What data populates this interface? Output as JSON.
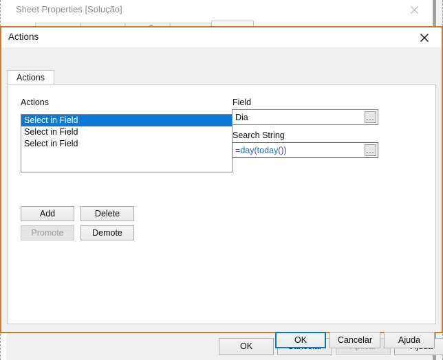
{
  "parent_window": {
    "title": "Sheet Properties [Solução]",
    "close_icon": "close-icon",
    "peek_tab_glyph": "T.",
    "footer_buttons": [
      {
        "label": "OK",
        "state": "enabled"
      },
      {
        "label": "Cancelar",
        "state": "enabled"
      },
      {
        "label": "Aplicar",
        "state": "disabled"
      },
      {
        "label": "Ajuda",
        "state": "enabled"
      }
    ]
  },
  "actions_dialog": {
    "title": "Actions",
    "close_icon": "close-icon",
    "tabs": [
      {
        "label": "Actions",
        "active": true
      }
    ],
    "left_panel": {
      "group_label": "Actions",
      "list_items": [
        {
          "label": "Select in Field",
          "selected": true
        },
        {
          "label": "Select in Field",
          "selected": false
        },
        {
          "label": "Select in Field",
          "selected": false
        }
      ],
      "buttons": [
        {
          "label": "Add",
          "state": "enabled"
        },
        {
          "label": "Delete",
          "state": "enabled"
        },
        {
          "label": "Promote",
          "state": "disabled"
        },
        {
          "label": "Demote",
          "state": "enabled"
        }
      ]
    },
    "right_panel": {
      "field_label": "Field",
      "field_value": "Dia",
      "field_browse_label": "...",
      "search_label": "Search String",
      "search_value": "=day(today())",
      "search_tokens": [
        {
          "text": "=",
          "kind": "op"
        },
        {
          "text": "day",
          "kind": "fn"
        },
        {
          "text": "(",
          "kind": "par"
        },
        {
          "text": "today",
          "kind": "fn"
        },
        {
          "text": "()",
          "kind": "par"
        },
        {
          "text": ")",
          "kind": "par"
        }
      ],
      "search_browse_label": "..."
    },
    "footer_buttons": [
      {
        "label": "OK",
        "state": "default"
      },
      {
        "label": "Cancelar",
        "state": "enabled"
      },
      {
        "label": "Ajuda",
        "state": "enabled"
      }
    ]
  },
  "colors": {
    "dialog_border": "#d0782d",
    "selection_blue": "#0b7ad6",
    "focus_blue": "#0078d7",
    "window_bg": "#f0f0f0"
  }
}
